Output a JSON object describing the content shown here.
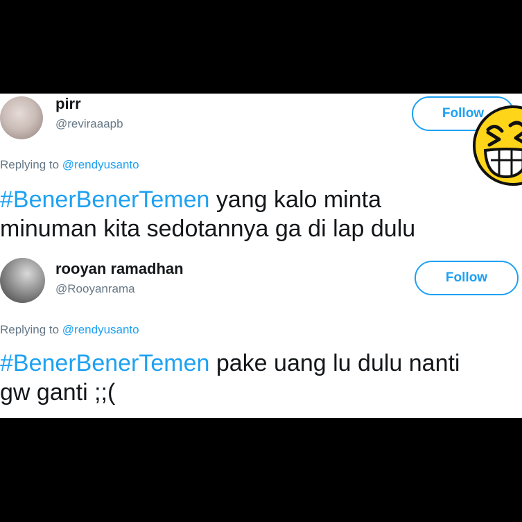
{
  "tweets": [
    {
      "name": "pirr",
      "handle": "@reviraaapb",
      "follow_label": "Follow",
      "replying_prefix": "Replying to ",
      "replying_to": "@rendyusanto",
      "hashtag": "#BenerBenerTemen",
      "text_line1": " yang kalo minta",
      "text_line2": "minuman kita sedotannya ga di lap dulu"
    },
    {
      "name": "rooyan ramadhan",
      "handle": "@Rooyanrama",
      "follow_label": "Follow",
      "replying_prefix": "Replying to ",
      "replying_to": "@rendyusanto",
      "hashtag": "#BenerBenerTemen",
      "text_line1": " pake uang lu dulu nanti",
      "text_line2": "gw ganti ;;("
    }
  ],
  "colors": {
    "accent": "#1da1f2",
    "text": "#14171a",
    "muted": "#657786",
    "emoji_face": "#ffd51a"
  },
  "icons": {
    "sticker": "laughing-face-icon"
  }
}
